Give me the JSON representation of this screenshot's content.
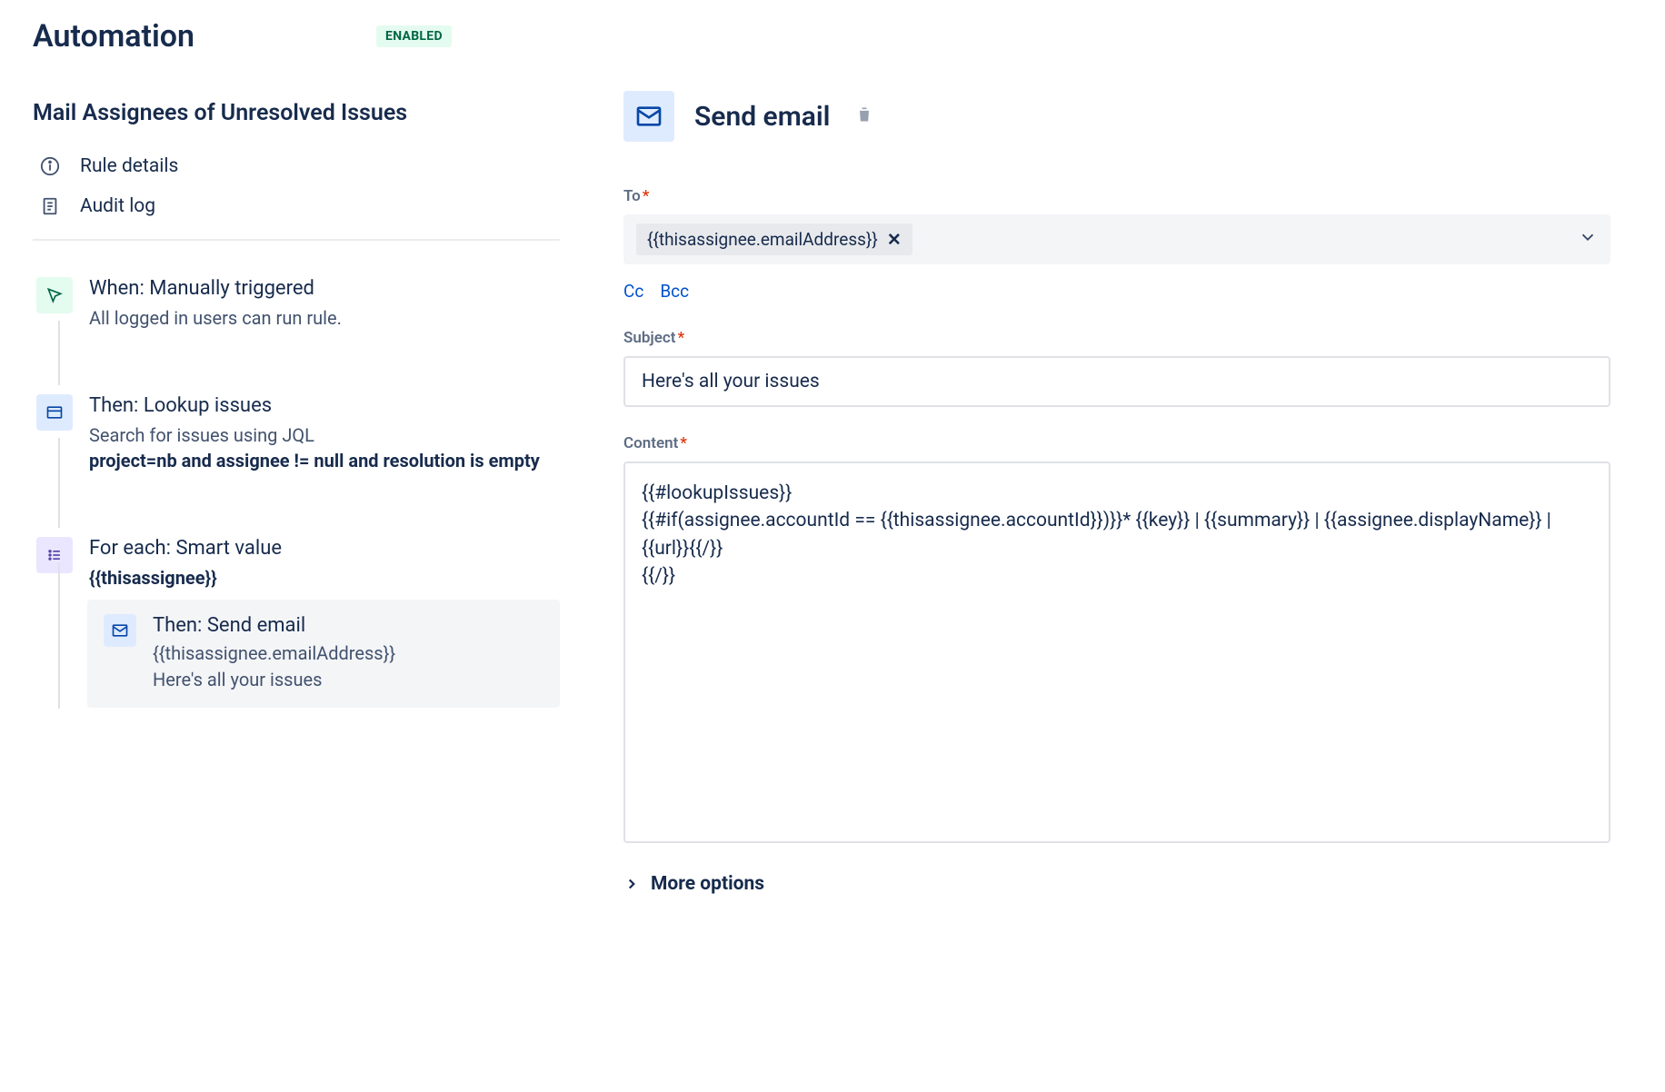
{
  "header": {
    "title": "Automation",
    "status_badge": "ENABLED"
  },
  "rule": {
    "name": "Mail Assignees of Unresolved Issues",
    "menu": {
      "details": "Rule details",
      "audit": "Audit log"
    }
  },
  "flow": {
    "trigger": {
      "title": "When: Manually triggered",
      "sub": "All logged in users can run rule."
    },
    "lookup": {
      "title": "Then: Lookup issues",
      "sub_pre": "Search for issues using JQL",
      "jql": "project=nb and assignee != null and resolution is empty"
    },
    "foreach": {
      "title": "For each: Smart value",
      "value": "{{thisassignee}}"
    },
    "email_card": {
      "title": "Then: Send email",
      "line1": "{{thisassignee.emailAddress}}",
      "line2": "Here's all your issues"
    }
  },
  "panel": {
    "title": "Send email",
    "fields": {
      "to_label": "To",
      "to_chip": "{{thisassignee.emailAddress}}",
      "cc": "Cc",
      "bcc": "Bcc",
      "subject_label": "Subject",
      "subject_value": "Here's all your issues",
      "content_label": "Content",
      "content_value": "{{#lookupIssues}}\n{{#if(assignee.accountId == {{thisassignee.accountId}})}}* {{key}} | {{summary}} | {{assignee.displayName}} | {{url}}{{/}}\n{{/}}",
      "more_options": "More options"
    }
  }
}
